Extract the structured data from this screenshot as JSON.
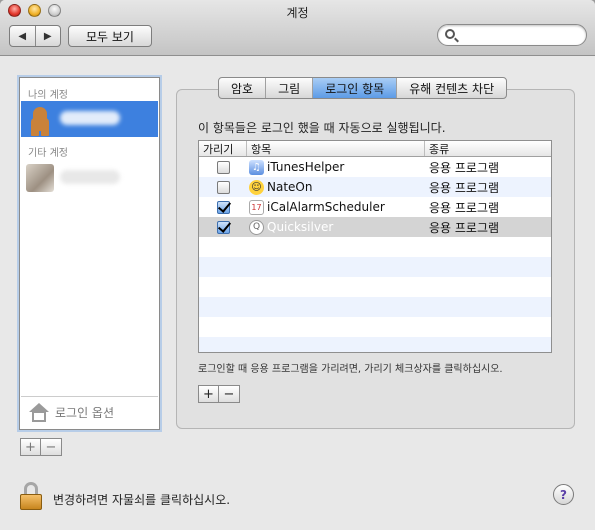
{
  "window": {
    "title": "계정"
  },
  "toolbar": {
    "back_icon": "◀",
    "forward_icon": "▶",
    "show_all_label": "모두 보기",
    "search_placeholder": "",
    "search_value": ""
  },
  "sidebar": {
    "my_account_header": "나의 계정",
    "my_account_name": "관리자",
    "other_accounts_header": "기타 계정",
    "login_options_label": "로그인 옵션",
    "add_label": "+",
    "remove_label": "−"
  },
  "tabs": [
    {
      "label": "암호",
      "active": false
    },
    {
      "label": "그림",
      "active": false
    },
    {
      "label": "로그인 항목",
      "active": true
    },
    {
      "label": "유해 컨텐츠 차단",
      "active": false
    }
  ],
  "login_items": {
    "description": "이 항목들은 로그인 했을 때 자동으로 실행됩니다.",
    "columns": [
      "가리기",
      "항목",
      "종류"
    ],
    "rows": [
      {
        "hide": false,
        "icon": "itunes-icon",
        "name": "iTunesHelper",
        "kind": "응용 프로그램"
      },
      {
        "hide": false,
        "icon": "nateon-icon",
        "name": "NateOn",
        "kind": "응용 프로그램"
      },
      {
        "hide": true,
        "icon": "ical-icon",
        "name": "iCalAlarmScheduler",
        "kind": "응용 프로그램"
      },
      {
        "hide": true,
        "icon": "quicksilver-icon",
        "name": "Quicksilver",
        "kind": "응용 프로그램"
      }
    ],
    "hint": "로그인할 때 응용 프로그램을 가리려면, 가리기 체크상자를 클릭하십시오.",
    "add_label": "+",
    "remove_label": "−"
  },
  "footer": {
    "lock_text": "변경하려면 자물쇠를 클릭하십시오.",
    "help_label": "?"
  },
  "colors": {
    "selection": "#3d80df",
    "active_tab": "#5d9be6",
    "row_alt": "#edf3fe"
  }
}
